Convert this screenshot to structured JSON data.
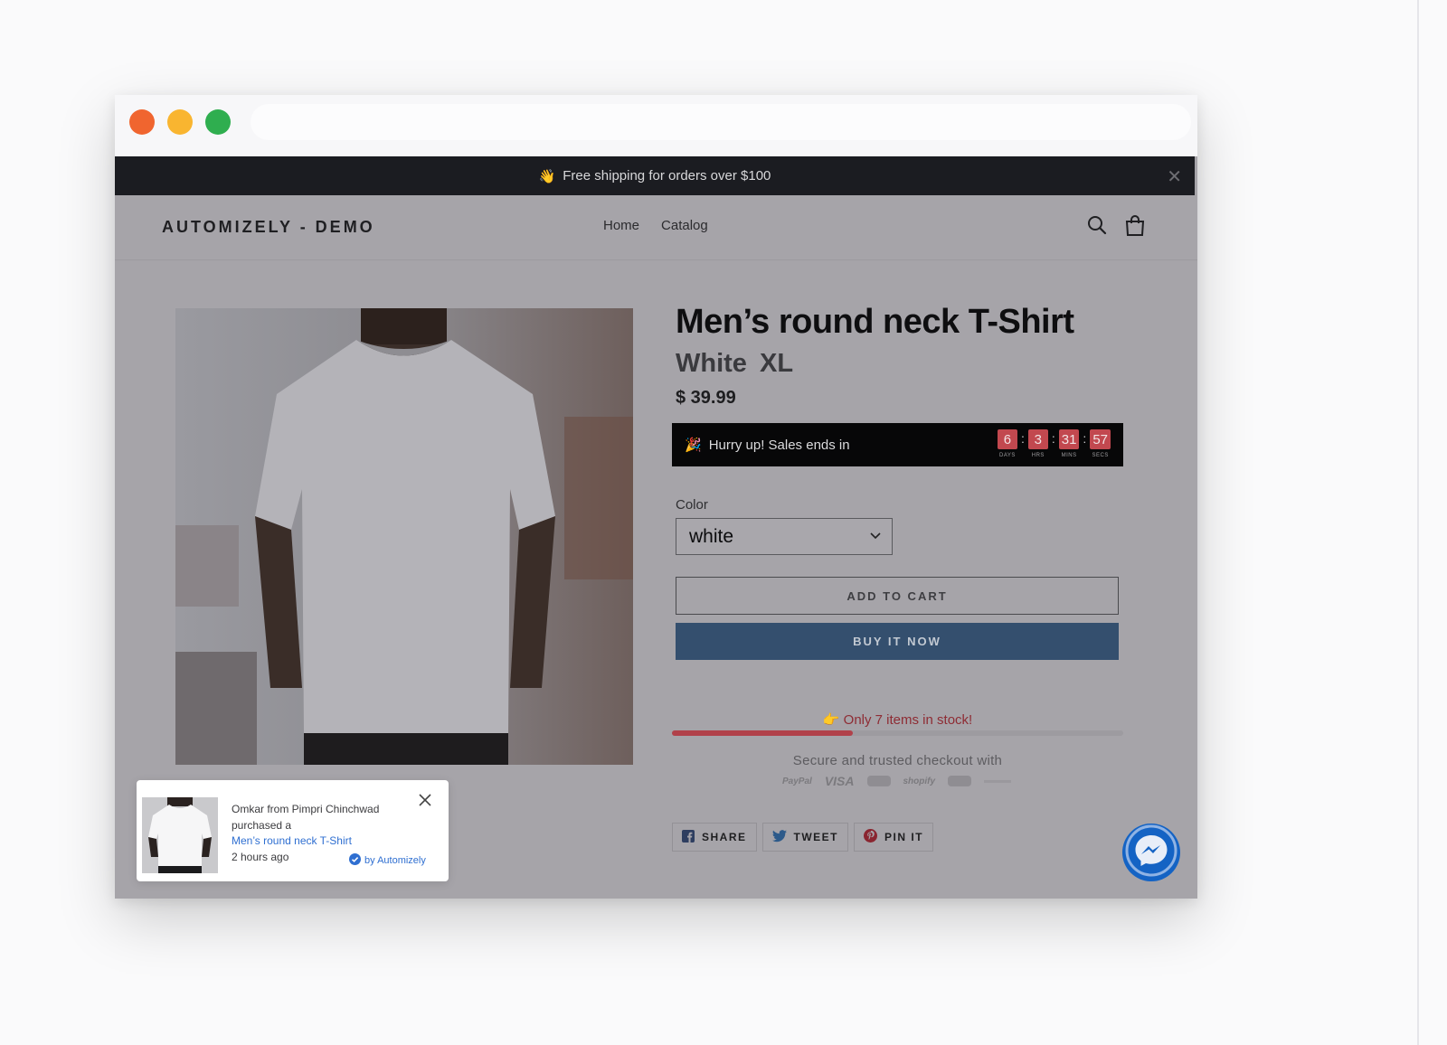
{
  "announcement": {
    "emoji": "👋",
    "text": "Free shipping for orders over $100"
  },
  "header": {
    "logo": "AUTOMIZELY - DEMO",
    "nav": [
      "Home",
      "Catalog"
    ]
  },
  "product": {
    "title": "Men’s round neck T-Shirt",
    "variant": "White  XL",
    "price": "$ 39.99",
    "color_label": "Color",
    "color_value": "white",
    "add_to_cart": "ADD TO CART",
    "buy_now": "BUY IT NOW"
  },
  "countdown": {
    "emoji": "🎉",
    "text": "Hurry up! Sales ends in",
    "days": "6",
    "hours": "3",
    "mins": "31",
    "secs": "57",
    "labels": {
      "days": "DAYS",
      "hours": "HRS",
      "mins": "MINS",
      "secs": "SECS"
    },
    "accent": "#c2484f"
  },
  "stock": {
    "emoji": "👉",
    "text": "Only 7 items in stock!",
    "fill_fraction": 0.4
  },
  "checkout": {
    "text": "Secure and trusted checkout with",
    "methods": [
      "PayPal",
      "VISA",
      "mastercard",
      "shopify",
      "diners",
      "amazon"
    ]
  },
  "share": {
    "facebook": "SHARE",
    "twitter": "TWEET",
    "pinterest": "PIN IT"
  },
  "toast": {
    "line1": "Omkar from Pimpri Chinchwad",
    "line2": "purchased a",
    "product": "Men’s round neck T-Shirt",
    "time": "2 hours ago",
    "by": "by Automizely"
  },
  "colors": {
    "buy_button": "#344f6e",
    "messenger": "#1463c4",
    "link": "#2f6fd1"
  }
}
